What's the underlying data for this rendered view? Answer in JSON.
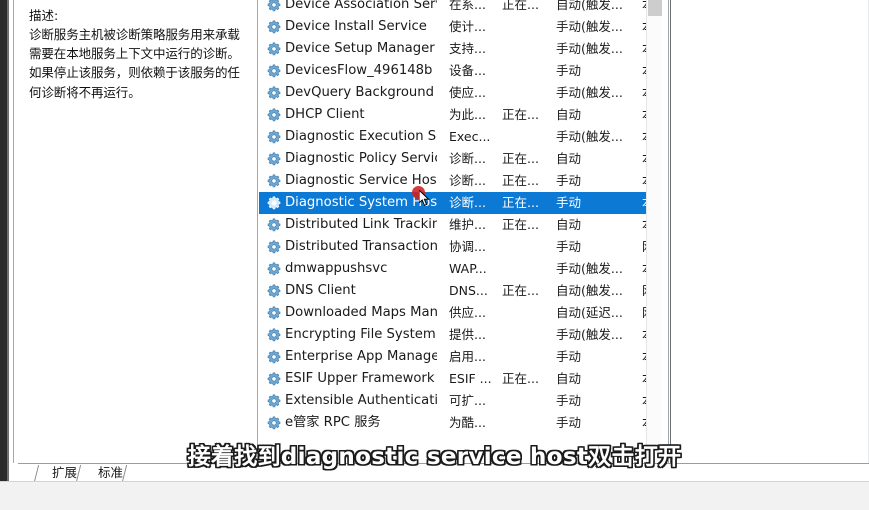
{
  "window": {
    "app": "services-mmc",
    "description_panel": {
      "title": "描述:",
      "body": "诊断服务主机被诊断策略服务用来承载需要在本地服务上下文中运行的诊断。如果停止该服务，则依赖于该服务的任何诊断将不再运行。"
    }
  },
  "list": {
    "icon": "gear-icon",
    "selected_index": 9,
    "rows": [
      {
        "name": "Device Association Service",
        "desc": "在系...",
        "status": "正在...",
        "startup": "自动(触发...",
        "logon": "本"
      },
      {
        "name": "Device Install Service",
        "desc": "使计...",
        "status": "",
        "startup": "手动(触发...",
        "logon": "本"
      },
      {
        "name": "Device Setup Manager",
        "desc": "支持...",
        "status": "",
        "startup": "手动(触发...",
        "logon": "本"
      },
      {
        "name": "DevicesFlow_496148b",
        "desc": "设备...",
        "status": "",
        "startup": "手动",
        "logon": "本"
      },
      {
        "name": "DevQuery Background Dis...",
        "desc": "使应...",
        "status": "",
        "startup": "手动(触发...",
        "logon": "本"
      },
      {
        "name": "DHCP Client",
        "desc": "为此...",
        "status": "正在...",
        "startup": "自动",
        "logon": "本"
      },
      {
        "name": "Diagnostic Execution Service",
        "desc": "Exec...",
        "status": "",
        "startup": "手动(触发...",
        "logon": "本"
      },
      {
        "name": "Diagnostic Policy Service",
        "desc": "诊断...",
        "status": "正在...",
        "startup": "自动",
        "logon": "本"
      },
      {
        "name": "Diagnostic Service Host",
        "desc": "诊断...",
        "status": "正在...",
        "startup": "手动",
        "logon": "本"
      },
      {
        "name": "Diagnostic System Host",
        "desc": "诊断...",
        "status": "正在...",
        "startup": "手动",
        "logon": "本"
      },
      {
        "name": "Distributed Link Tracking C...",
        "desc": "维护...",
        "status": "正在...",
        "startup": "自动",
        "logon": "本"
      },
      {
        "name": "Distributed Transaction Co...",
        "desc": "协调...",
        "status": "",
        "startup": "手动",
        "logon": "网"
      },
      {
        "name": "dmwappushsvc",
        "desc": "WAP...",
        "status": "",
        "startup": "手动(触发...",
        "logon": "本"
      },
      {
        "name": "DNS Client",
        "desc": "DNS...",
        "status": "正在...",
        "startup": "自动(触发...",
        "logon": "网"
      },
      {
        "name": "Downloaded Maps Manager",
        "desc": "供应...",
        "status": "",
        "startup": "自动(延迟...",
        "logon": "网"
      },
      {
        "name": "Encrypting File System (EFS)",
        "desc": "提供...",
        "status": "",
        "startup": "手动(触发...",
        "logon": "本"
      },
      {
        "name": "Enterprise App Manageme...",
        "desc": "启用...",
        "status": "",
        "startup": "手动",
        "logon": "本"
      },
      {
        "name": "ESIF Upper Framework Ser...",
        "desc": "ESIF ...",
        "status": "正在...",
        "startup": "自动",
        "logon": "本"
      },
      {
        "name": "Extensible Authentication ...",
        "desc": "可扩...",
        "status": "",
        "startup": "手动",
        "logon": "本"
      },
      {
        "name": "e管家 RPC 服务",
        "desc": "为酷...",
        "status": "",
        "startup": "手动",
        "logon": "本"
      }
    ]
  },
  "tabs": [
    {
      "label": "扩展"
    },
    {
      "label": "标准"
    }
  ],
  "subtitle": {
    "text": "接着找到diagnostic service host双击打开"
  },
  "colors": {
    "selection_blue": "#0c7ad4",
    "cursor_red": "#d21f1f",
    "panel_border": "#a9a9a9"
  }
}
